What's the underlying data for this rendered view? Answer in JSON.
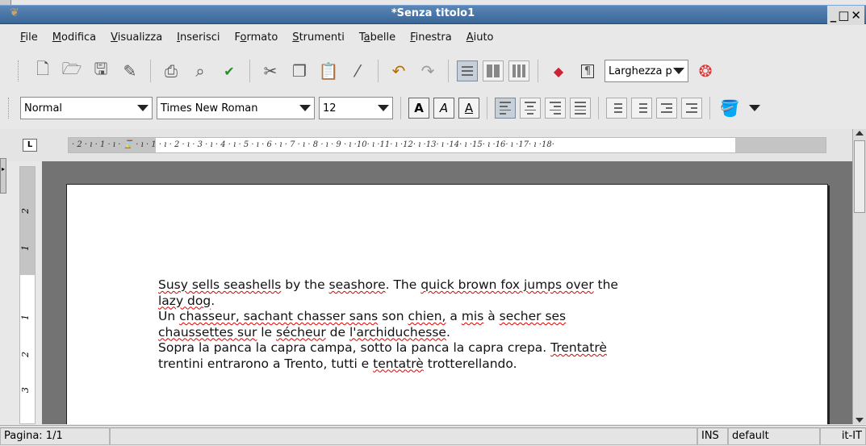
{
  "window": {
    "title": "*Senza titolo1"
  },
  "menubar": {
    "items": [
      {
        "label": "File",
        "ul": "F",
        "rest": "ile"
      },
      {
        "label": "Modifica",
        "ul": "M",
        "rest": "odifica"
      },
      {
        "label": "Visualizza",
        "ul": "V",
        "rest": "isualizza"
      },
      {
        "label": "Inserisci",
        "ul": "I",
        "rest": "nserisci"
      },
      {
        "label": "Formato",
        "pre": "F",
        "ul": "o",
        "rest": "rmato"
      },
      {
        "label": "Strumenti",
        "ul": "S",
        "rest": "trumenti"
      },
      {
        "label": "Tabelle",
        "pre": "T",
        "ul": "a",
        "rest": "belle"
      },
      {
        "label": "Finestra",
        "ul": "F",
        "rest": "inestra"
      },
      {
        "label": "Aiuto",
        "ul": "A",
        "rest": "iuto"
      }
    ]
  },
  "toolbar1": {
    "zoom_value": "Larghezza p"
  },
  "toolbar2": {
    "style_value": "Normal",
    "font_value": "Times New Roman",
    "size_value": "12",
    "bold_label": "A",
    "italic_label": "A",
    "underline_label": "A"
  },
  "ruler": {
    "text": "· 2 · ı · 1 · ı · ⌛ · ı · 1 · ı · 2 · ı · 3 · ı · 4 · ı · 5 · ı · 6 · ı · 7 · ı · 8 · ı · 9 · ı ·10· ı ·11· ı ·12· ı ·13· ı ·14· ı ·15· ı ·16· ı ·17· ı ·18·"
  },
  "document": {
    "line1a": "Susy sells seashells",
    "line1b": " by the ",
    "line1c": "seashore",
    "line1d": ". The ",
    "line1e": "quick brown fox jumps over",
    "line1f": " the",
    "line2": "lazy dog",
    "line2end": ".",
    "line3a": "Un ",
    "line3b": "chasseur, sachant chasser sans",
    "line3c": " son ",
    "line3d": "chien,",
    "line3e": " a ",
    "line3f": "mis",
    "line3g": " à ",
    "line3h": "secher ses",
    "line4a": "chaussettes sur",
    "line4b": " le ",
    "line4c": "sécheur",
    "line4d": " de ",
    "line4e": "l'archiduchesse",
    "line4f": ".",
    "line5a": "Sopra la panca la capra campa, sotto la panca la capra crepa. ",
    "line5b": "Trentatrè",
    "line6a": "trentini entrarono a Trento, tutti e ",
    "line6b": "tentatrè",
    "line6c": " trotterellando."
  },
  "statusbar": {
    "page": "Pagina: 1/1",
    "mode": "INS",
    "style": "default",
    "lang": "it-IT"
  },
  "icons": [
    "new-document-icon",
    "open-folder-icon",
    "save-icon",
    "save-as-icon",
    "print-icon",
    "print-preview-icon",
    "spellcheck-icon",
    "cut-icon",
    "copy-icon",
    "paste-icon",
    "format-painter-icon",
    "undo-icon",
    "redo-icon",
    "one-column-icon",
    "two-columns-icon",
    "three-columns-icon",
    "insert-image-icon",
    "show-formatting-marks-icon",
    "help-lifebuoy-icon"
  ]
}
